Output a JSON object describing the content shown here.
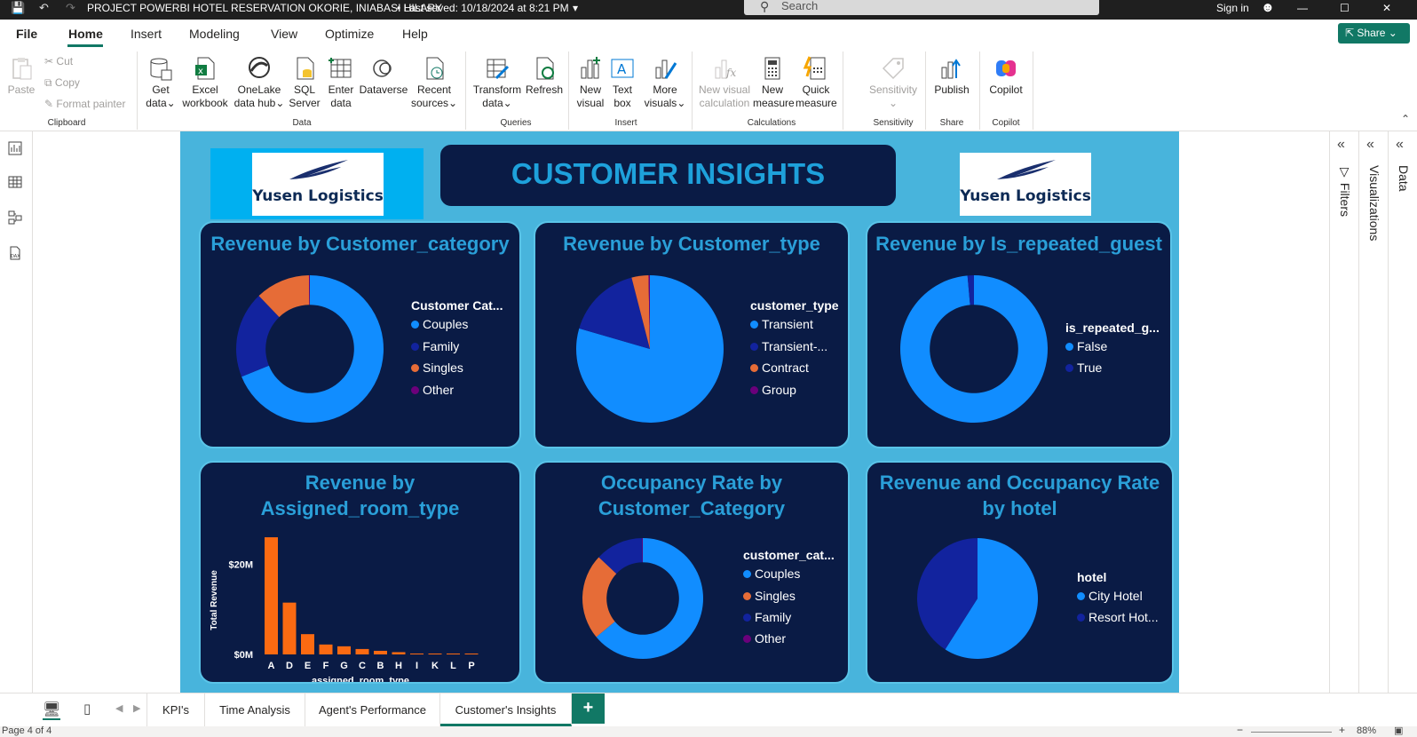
{
  "titlebar": {
    "title": "PROJECT POWERBI HOTEL RESERVATION OKORIE, INIABASI HILARY",
    "saved": "• Last saved: 10/18/2024 at 8:21 PM",
    "search_placeholder": "Search",
    "sign_in": "Sign in"
  },
  "menu_tabs": [
    "File",
    "Home",
    "Insert",
    "Modeling",
    "View",
    "Optimize",
    "Help"
  ],
  "share_label": "Share",
  "ribbon": {
    "paste": "Paste",
    "cut": "Cut",
    "copy": "Copy",
    "format_painter": "Format painter",
    "clipboard_group": "Clipboard",
    "get_data": [
      "Get",
      "data"
    ],
    "excel_workbook": [
      "Excel",
      "workbook"
    ],
    "onelake": [
      "OneLake",
      "data hub"
    ],
    "sql_server": [
      "SQL",
      "Server"
    ],
    "enter_data": [
      "Enter",
      "data"
    ],
    "dataverse": "Dataverse",
    "recent_sources": [
      "Recent",
      "sources"
    ],
    "data_group": "Data",
    "transform": [
      "Transform",
      "data"
    ],
    "refresh": "Refresh",
    "queries_group": "Queries",
    "new_visual": [
      "New",
      "visual"
    ],
    "text_box": [
      "Text",
      "box"
    ],
    "more_visuals": [
      "More",
      "visuals"
    ],
    "insert_group": "Insert",
    "new_visual_calc": [
      "New visual",
      "calculation"
    ],
    "new_measure": [
      "New",
      "measure"
    ],
    "quick_measure": [
      "Quick",
      "measure"
    ],
    "calculations_group": "Calculations",
    "sensitivity": "Sensitivity",
    "sensitivity_group": "Sensitivity",
    "publish": "Publish",
    "share_group": "Share",
    "copilot": "Copilot",
    "copilot_group": "Copilot"
  },
  "report": {
    "logo_text": "Yusen Logistics",
    "main_title": "CUSTOMER INSIGHTS",
    "cards": {
      "c1": {
        "title": "Revenue by Customer_category",
        "legend_title": "Customer Cat...",
        "legend": [
          "Couples",
          "Family",
          "Singles",
          "Other"
        ]
      },
      "c2": {
        "title": "Revenue by Customer_type",
        "legend_title": "customer_type",
        "legend": [
          "Transient",
          "Transient-...",
          "Contract",
          "Group"
        ]
      },
      "c3": {
        "title": "Revenue by Is_repeated_guest",
        "legend_title": "is_repeated_g...",
        "legend": [
          "False",
          "True"
        ]
      },
      "c4": {
        "title": "Revenue by Assigned_room_type"
      },
      "c5": {
        "title": "Occupancy Rate by Customer_Category",
        "legend_title": "customer_cat...",
        "legend": [
          "Couples",
          "Singles",
          "Family",
          "Other"
        ]
      },
      "c6": {
        "title": "Revenue and Occupancy Rate by hotel",
        "legend_title": "hotel",
        "legend": [
          "City Hotel",
          "Resort Hot..."
        ]
      }
    }
  },
  "colors": {
    "light_blue": "#118dff",
    "dark_blue": "#12239e",
    "orange": "#e66c37",
    "purple": "#6b007b",
    "bar_orange": "#fb6a12"
  },
  "chart_data": [
    {
      "type": "pie",
      "variant": "donut",
      "title": "Revenue by Customer_category",
      "categories": [
        "Couples",
        "Family",
        "Singles",
        "Other"
      ],
      "values": [
        69,
        19,
        12,
        0.2
      ]
    },
    {
      "type": "pie",
      "title": "Revenue by Customer_type",
      "categories": [
        "Transient",
        "Transient-...",
        "Contract",
        "Group"
      ],
      "values": [
        79.5,
        16.5,
        3.7,
        0.3
      ]
    },
    {
      "type": "pie",
      "variant": "donut",
      "title": "Revenue by Is_repeated_guest",
      "categories": [
        "False",
        "True"
      ],
      "values": [
        98.6,
        1.4
      ]
    },
    {
      "type": "bar",
      "title": "Revenue by Assigned_room_type",
      "xlabel": "assigned_room_type",
      "ylabel": "Total Revenue",
      "categories": [
        "A",
        "D",
        "E",
        "F",
        "G",
        "C",
        "B",
        "H",
        "I",
        "K",
        "L",
        "P"
      ],
      "values": [
        26,
        11.5,
        4.5,
        2.2,
        1.8,
        1.2,
        0.8,
        0.5,
        0.2,
        0.15,
        0.05,
        0.01
      ],
      "units": "$M",
      "yticks": [
        "$0M",
        "$20M"
      ],
      "ylim": [
        0,
        27
      ]
    },
    {
      "type": "pie",
      "variant": "donut",
      "title": "Occupancy Rate by Customer_Category",
      "categories": [
        "Couples",
        "Singles",
        "Family",
        "Other"
      ],
      "values": [
        64,
        23,
        12.8,
        0.2
      ]
    },
    {
      "type": "pie",
      "title": "Revenue and Occupancy Rate by hotel",
      "categories": [
        "City Hotel",
        "Resort Hot..."
      ],
      "values": [
        59,
        41
      ]
    }
  ],
  "right_panes": {
    "filters": "Filters",
    "visualizations": "Visualizations",
    "data": "Data"
  },
  "pages": [
    "KPI's",
    "Time Analysis",
    "Agent's Performance",
    "Customer's Insights"
  ],
  "add_page": "+",
  "status": {
    "page": "Page 4 of 4",
    "zoom": "88%",
    "zoom_minus": "−",
    "zoom_plus": "+"
  }
}
